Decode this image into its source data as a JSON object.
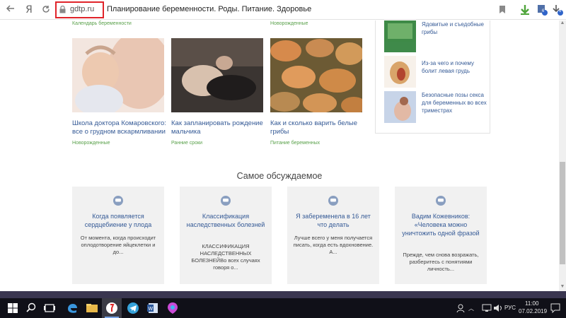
{
  "browser": {
    "back_icon": "back-arrow-icon",
    "yandex_glyph": "Я",
    "domain": "gdtp.ru",
    "page_title": "Планирование беременности. Роды. Питание. Здоровье",
    "badge_count_1": "6",
    "badge_count_2": "6"
  },
  "top_tags": {
    "left": "Календарь беременности",
    "right": "Новорожденные"
  },
  "articles": [
    {
      "title": "Школа доктора Комаровского: все о грудном вскармливании",
      "tag": "Новорожденные"
    },
    {
      "title": "Как запланировать рождение мальчика",
      "tag": "Ранние сроки"
    },
    {
      "title": "Как и сколько варить белые грибы",
      "tag": "Питание беременных"
    }
  ],
  "sidebar": {
    "items": [
      {
        "text": "Ядовитые и съедобные грибы"
      },
      {
        "text": "Из-за чего и почему болит левая грудь"
      },
      {
        "text": "Безопасные позы секса для беременных во всех триместрах"
      }
    ]
  },
  "discussed": {
    "heading": "Самое обсуждаемое",
    "cards": [
      {
        "title": "Когда появляется сердцебиение у плода",
        "body": "От момента, когда происходит оплодотворение яйцеклетки и до..."
      },
      {
        "title": "Классификация наследственных болезней",
        "body": "КЛАССИФИКАЦИЯ НАСЛЕДСТВЕННЫХ БОЛЕЗНЕЙВо всех случаях говоря о..."
      },
      {
        "title": "Я забеременела в 16 лет что делать",
        "body": "Лучше всего у меня получается писать, когда есть вдохновение. А..."
      },
      {
        "title": "Вадим Кожевников: «Человека можно уничтожить одной фразой",
        "body": "Прежде, чем снова возражать, разберитесь с понятиями личность..."
      }
    ]
  },
  "taskbar": {
    "lang": "РУС",
    "time": "11:00",
    "date": "07.02.2019"
  },
  "colors": {
    "link": "#355a96",
    "tag": "#5aa14b",
    "highlight": "#e0242a",
    "taskbar": "#101018"
  }
}
